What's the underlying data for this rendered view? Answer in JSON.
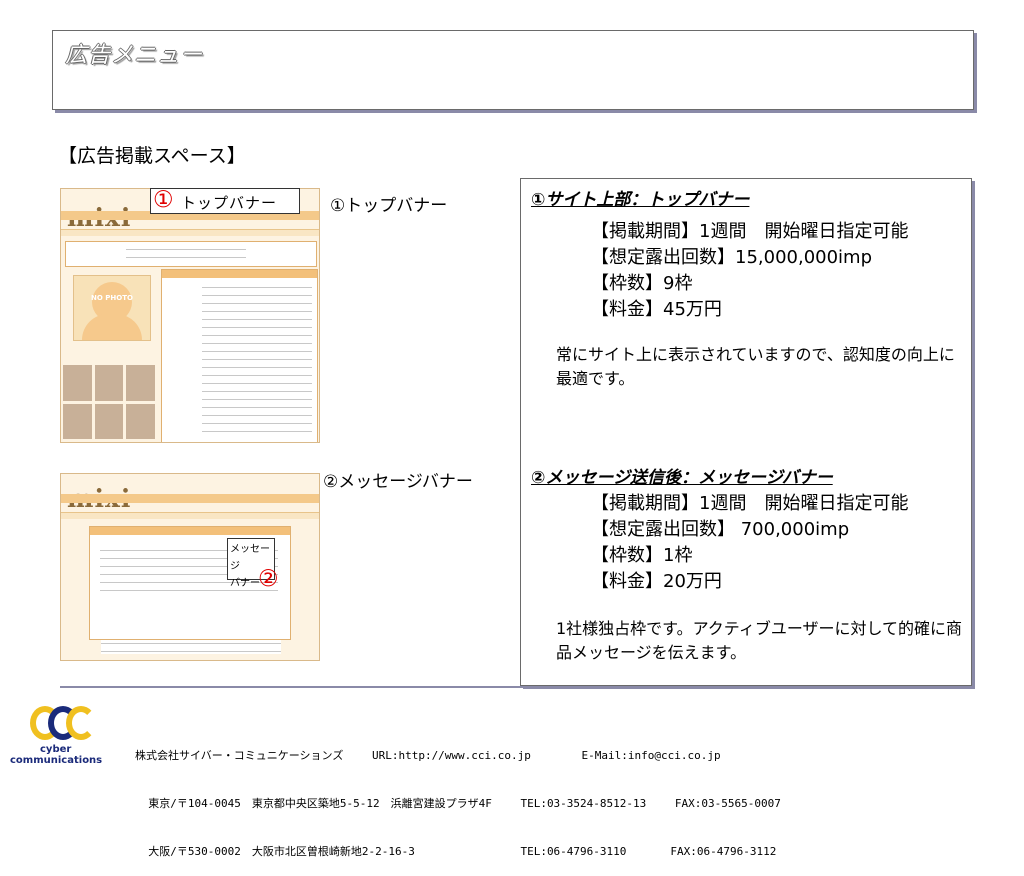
{
  "header": {
    "title": "広告メニュー"
  },
  "section_label": "【広告掲載スペース】",
  "screenshot1": {
    "logo": "mixi",
    "callout_number": "①",
    "callout_label": "トップバナー",
    "photo_label": "NO PHOTO"
  },
  "screenshot2": {
    "logo": "mixi",
    "callout_label_1": "メッセージ",
    "callout_label_2": "バナー",
    "callout_number": "②"
  },
  "captions": {
    "top": "①トップバナー",
    "message": "②メッセージバナー"
  },
  "plans": [
    {
      "heading": "①サイト上部：トップバナー",
      "period": "【掲載期間】1週間　開始曜日指定可能",
      "impressions": "【想定露出回数】15,000,000imp",
      "slots": "【枠数】9枠",
      "price": "【料金】45万円",
      "note": "常にサイト上に表示されていますので、認知度の向上に最適です。"
    },
    {
      "heading": "②メッセージ送信後：メッセージバナー",
      "period": "【掲載期間】1週間　開始曜日指定可能",
      "impressions": "【想定露出回数】 700,000imp",
      "slots": "【枠数】1枠",
      "price": "【料金】20万円",
      "note": "1社様独占枠です。アクティブユーザーに対して的確に商品メッセージを伝えます。"
    }
  ],
  "footer": {
    "logo_line1": "cyber",
    "logo_line2": "communications",
    "line1": "株式会社サイバー・コミュニケーションズ　　 URL:http://www.cci.co.jp　　　　 E-Mail:info@cci.co.jp",
    "line2": "  東京/〒104-0045　東京都中央区築地5-5-12　浜離宮建設プラザ4F　　 TEL:03-3524-8512-13　　 FAX:03-5565-0007",
    "line3": "  大阪/〒530-0002　大阪市北区曽根崎新地2-2-16-3　　　　　　　　　 TEL:06-4796-3110　　　　FAX:06-4796-3112"
  }
}
